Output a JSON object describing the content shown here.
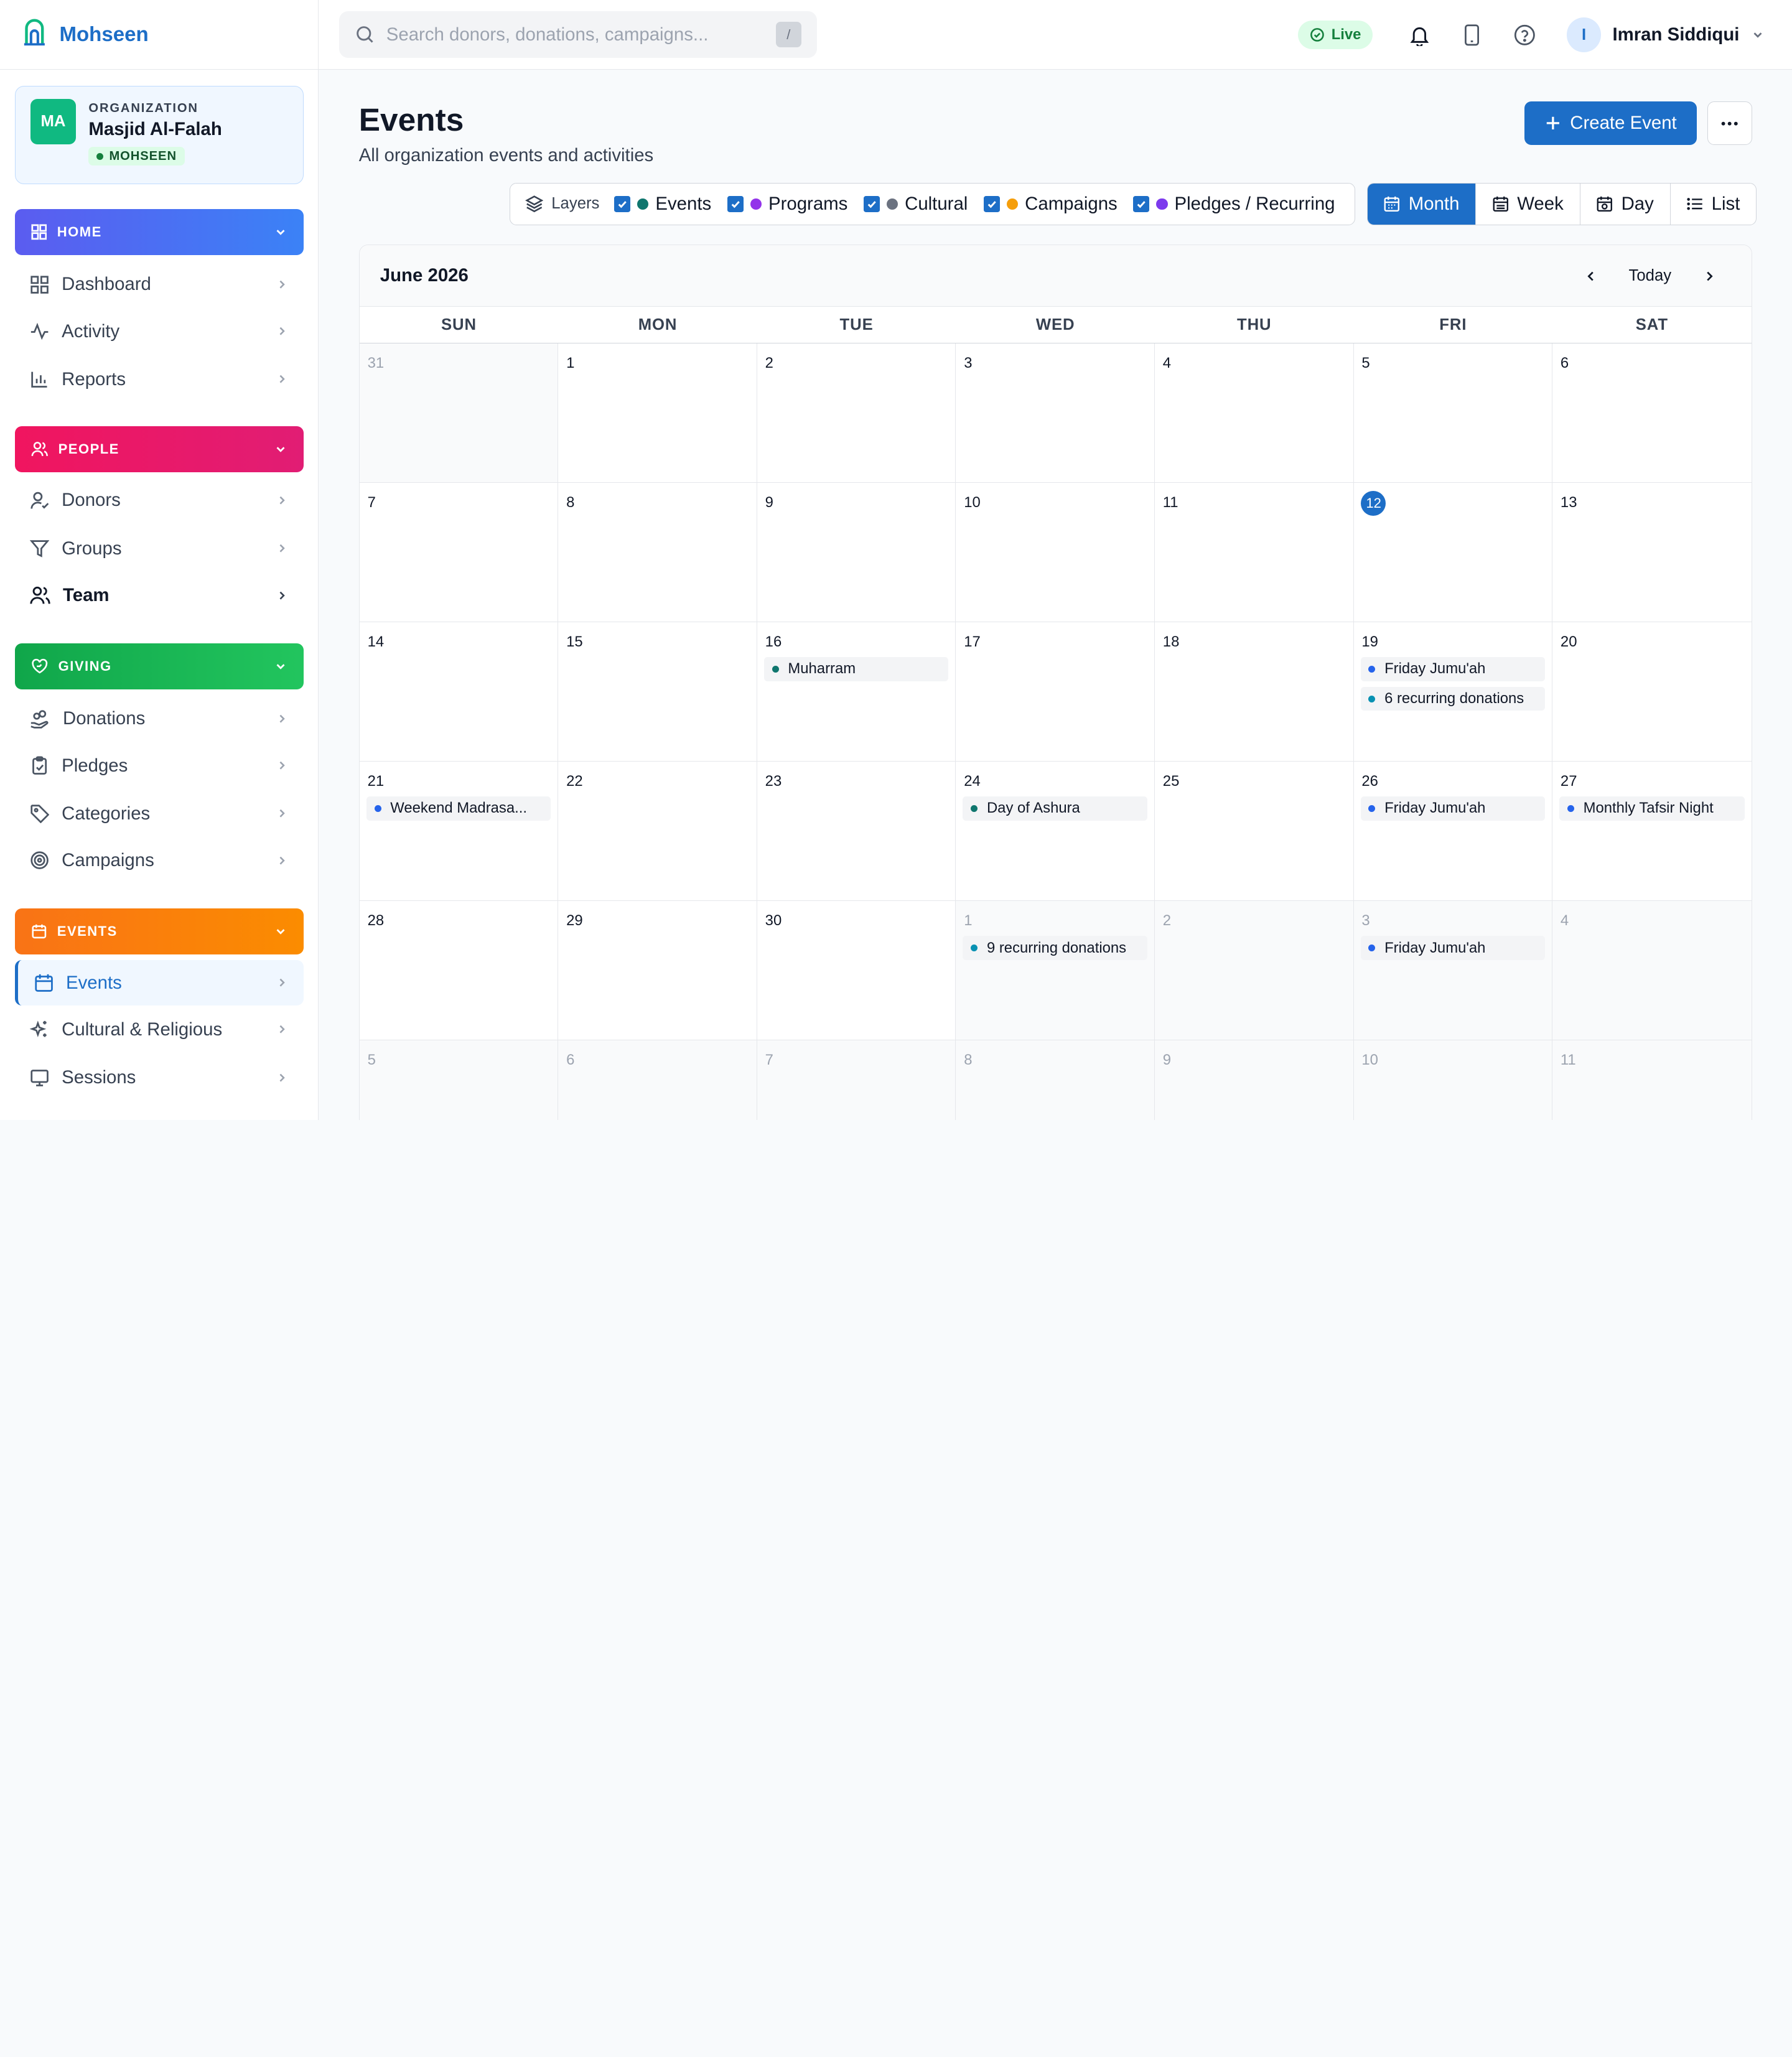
{
  "brand": {
    "name": "Mohseen"
  },
  "org": {
    "initials": "MA",
    "kicker": "ORGANIZATION",
    "name": "Masjid Al-Falah",
    "badge": "MOHSEEN"
  },
  "sidebar": {
    "home": {
      "label": "HOME",
      "color": "#5b5cf0",
      "items": [
        {
          "label": "Dashboard",
          "icon": "grid-icon"
        },
        {
          "label": "Activity",
          "icon": "activity-icon"
        },
        {
          "label": "Reports",
          "icon": "bar-chart-icon"
        }
      ]
    },
    "people": {
      "label": "PEOPLE",
      "color": "#f0155f",
      "items": [
        {
          "label": "Donors",
          "icon": "user-icon"
        },
        {
          "label": "Groups",
          "icon": "filter-icon"
        },
        {
          "label": "Team",
          "icon": "users-icon"
        }
      ]
    },
    "giving": {
      "label": "GIVING",
      "color": "#10b04f",
      "items": [
        {
          "label": "Donations",
          "icon": "hand-coins-icon"
        },
        {
          "label": "Pledges",
          "icon": "clipboard-icon"
        },
        {
          "label": "Categories",
          "icon": "tag-icon"
        },
        {
          "label": "Campaigns",
          "icon": "target-icon"
        }
      ]
    },
    "events": {
      "label": "EVENTS",
      "color": "#f97316",
      "items": [
        {
          "label": "Events",
          "icon": "calendar-icon"
        },
        {
          "label": "Cultural & Religious",
          "icon": "sparkles-icon"
        },
        {
          "label": "Sessions",
          "icon": "monitor-icon"
        }
      ]
    }
  },
  "topbar": {
    "search_placeholder": "Search donors, donations, campaigns...",
    "search_shortcut": "/",
    "live_label": "Live",
    "user_initial": "I",
    "user_name": "Imran Siddiqui"
  },
  "page": {
    "title": "Events",
    "subtitle": "All organization events and activities",
    "create_label": "Create Event"
  },
  "layers": {
    "label": "Layers",
    "items": [
      {
        "label": "Events",
        "color": "#0f766e",
        "checked": true
      },
      {
        "label": "Programs",
        "color": "#9333ea",
        "checked": true
      },
      {
        "label": "Cultural",
        "color": "#6b7280",
        "checked": true
      },
      {
        "label": "Campaigns",
        "color": "#f59e0b",
        "checked": true
      },
      {
        "label": "Pledges / Recurring",
        "color": "#7c3aed",
        "checked": true
      }
    ]
  },
  "views": {
    "items": [
      "Month",
      "Week",
      "Day",
      "List"
    ],
    "active": "Month"
  },
  "calendar": {
    "month_label": "June 2026",
    "today_label": "Today",
    "weekdays": [
      "SUN",
      "MON",
      "TUE",
      "WED",
      "THU",
      "FRI",
      "SAT"
    ],
    "today_day": 12,
    "colors": {
      "event": "#0f766e",
      "program": "#2563eb",
      "recurring": "#0891b2"
    },
    "cells": [
      {
        "day": "31",
        "other": true,
        "events": []
      },
      {
        "day": "1",
        "events": []
      },
      {
        "day": "2",
        "events": []
      },
      {
        "day": "3",
        "events": []
      },
      {
        "day": "4",
        "events": []
      },
      {
        "day": "5",
        "events": []
      },
      {
        "day": "6",
        "events": []
      },
      {
        "day": "7",
        "events": []
      },
      {
        "day": "8",
        "events": []
      },
      {
        "day": "9",
        "events": []
      },
      {
        "day": "10",
        "events": []
      },
      {
        "day": "11",
        "events": []
      },
      {
        "day": "12",
        "today": true,
        "events": []
      },
      {
        "day": "13",
        "events": []
      },
      {
        "day": "14",
        "events": []
      },
      {
        "day": "15",
        "events": []
      },
      {
        "day": "16",
        "events": [
          {
            "label": "Muharram",
            "kind": "event"
          }
        ]
      },
      {
        "day": "17",
        "events": []
      },
      {
        "day": "18",
        "events": []
      },
      {
        "day": "19",
        "events": [
          {
            "label": "Friday Jumu'ah",
            "kind": "program"
          },
          {
            "label": "6 recurring donations",
            "kind": "recurring"
          }
        ]
      },
      {
        "day": "20",
        "events": []
      },
      {
        "day": "21",
        "events": [
          {
            "label": "Weekend Madrasa...",
            "kind": "program"
          }
        ]
      },
      {
        "day": "22",
        "events": []
      },
      {
        "day": "23",
        "events": []
      },
      {
        "day": "24",
        "events": [
          {
            "label": "Day of Ashura",
            "kind": "event"
          }
        ]
      },
      {
        "day": "25",
        "events": []
      },
      {
        "day": "26",
        "events": [
          {
            "label": "Friday Jumu'ah",
            "kind": "program"
          }
        ]
      },
      {
        "day": "27",
        "events": [
          {
            "label": "Monthly Tafsir Night",
            "kind": "program"
          }
        ]
      },
      {
        "day": "28",
        "events": []
      },
      {
        "day": "29",
        "events": []
      },
      {
        "day": "30",
        "events": []
      },
      {
        "day": "1",
        "other": true,
        "events": [
          {
            "label": "9 recurring donations",
            "kind": "recurring"
          }
        ]
      },
      {
        "day": "2",
        "other": true,
        "events": []
      },
      {
        "day": "3",
        "other": true,
        "events": [
          {
            "label": "Friday Jumu'ah",
            "kind": "program"
          }
        ]
      },
      {
        "day": "4",
        "other": true,
        "events": []
      },
      {
        "day": "5",
        "other": true,
        "events": []
      },
      {
        "day": "6",
        "other": true,
        "events": []
      },
      {
        "day": "7",
        "other": true,
        "events": []
      },
      {
        "day": "8",
        "other": true,
        "events": []
      },
      {
        "day": "9",
        "other": true,
        "events": []
      },
      {
        "day": "10",
        "other": true,
        "events": []
      },
      {
        "day": "11",
        "other": true,
        "events": []
      }
    ]
  }
}
